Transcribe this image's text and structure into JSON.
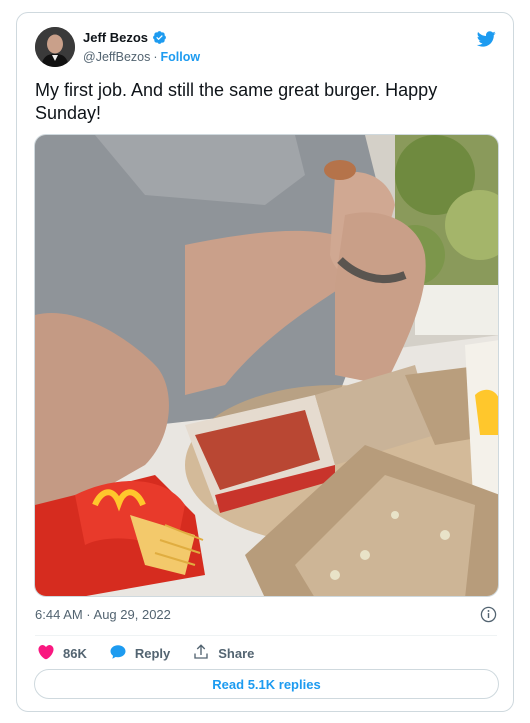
{
  "author": {
    "name": "Jeff Bezos",
    "handle": "@JeffBezos",
    "separator": "·",
    "follow_label": "Follow",
    "verified": true
  },
  "tweet": {
    "text": "My first job. And still the same great burger. Happy Sunday!",
    "timestamp": "6:44 AM · Aug 29, 2022"
  },
  "actions": {
    "likes": "86K",
    "reply_label": "Reply",
    "share_label": "Share"
  },
  "replies_button": "Read 5.1K replies",
  "colors": {
    "twitter_blue": "#1d9bf0",
    "like_pink": "#f91880",
    "text_primary": "#0f1419",
    "text_secondary": "#536471",
    "border": "#cfd9de"
  },
  "icons": [
    "verified-badge-icon",
    "twitter-bird-icon",
    "info-icon",
    "heart-icon",
    "reply-bubble-icon",
    "share-icon"
  ]
}
